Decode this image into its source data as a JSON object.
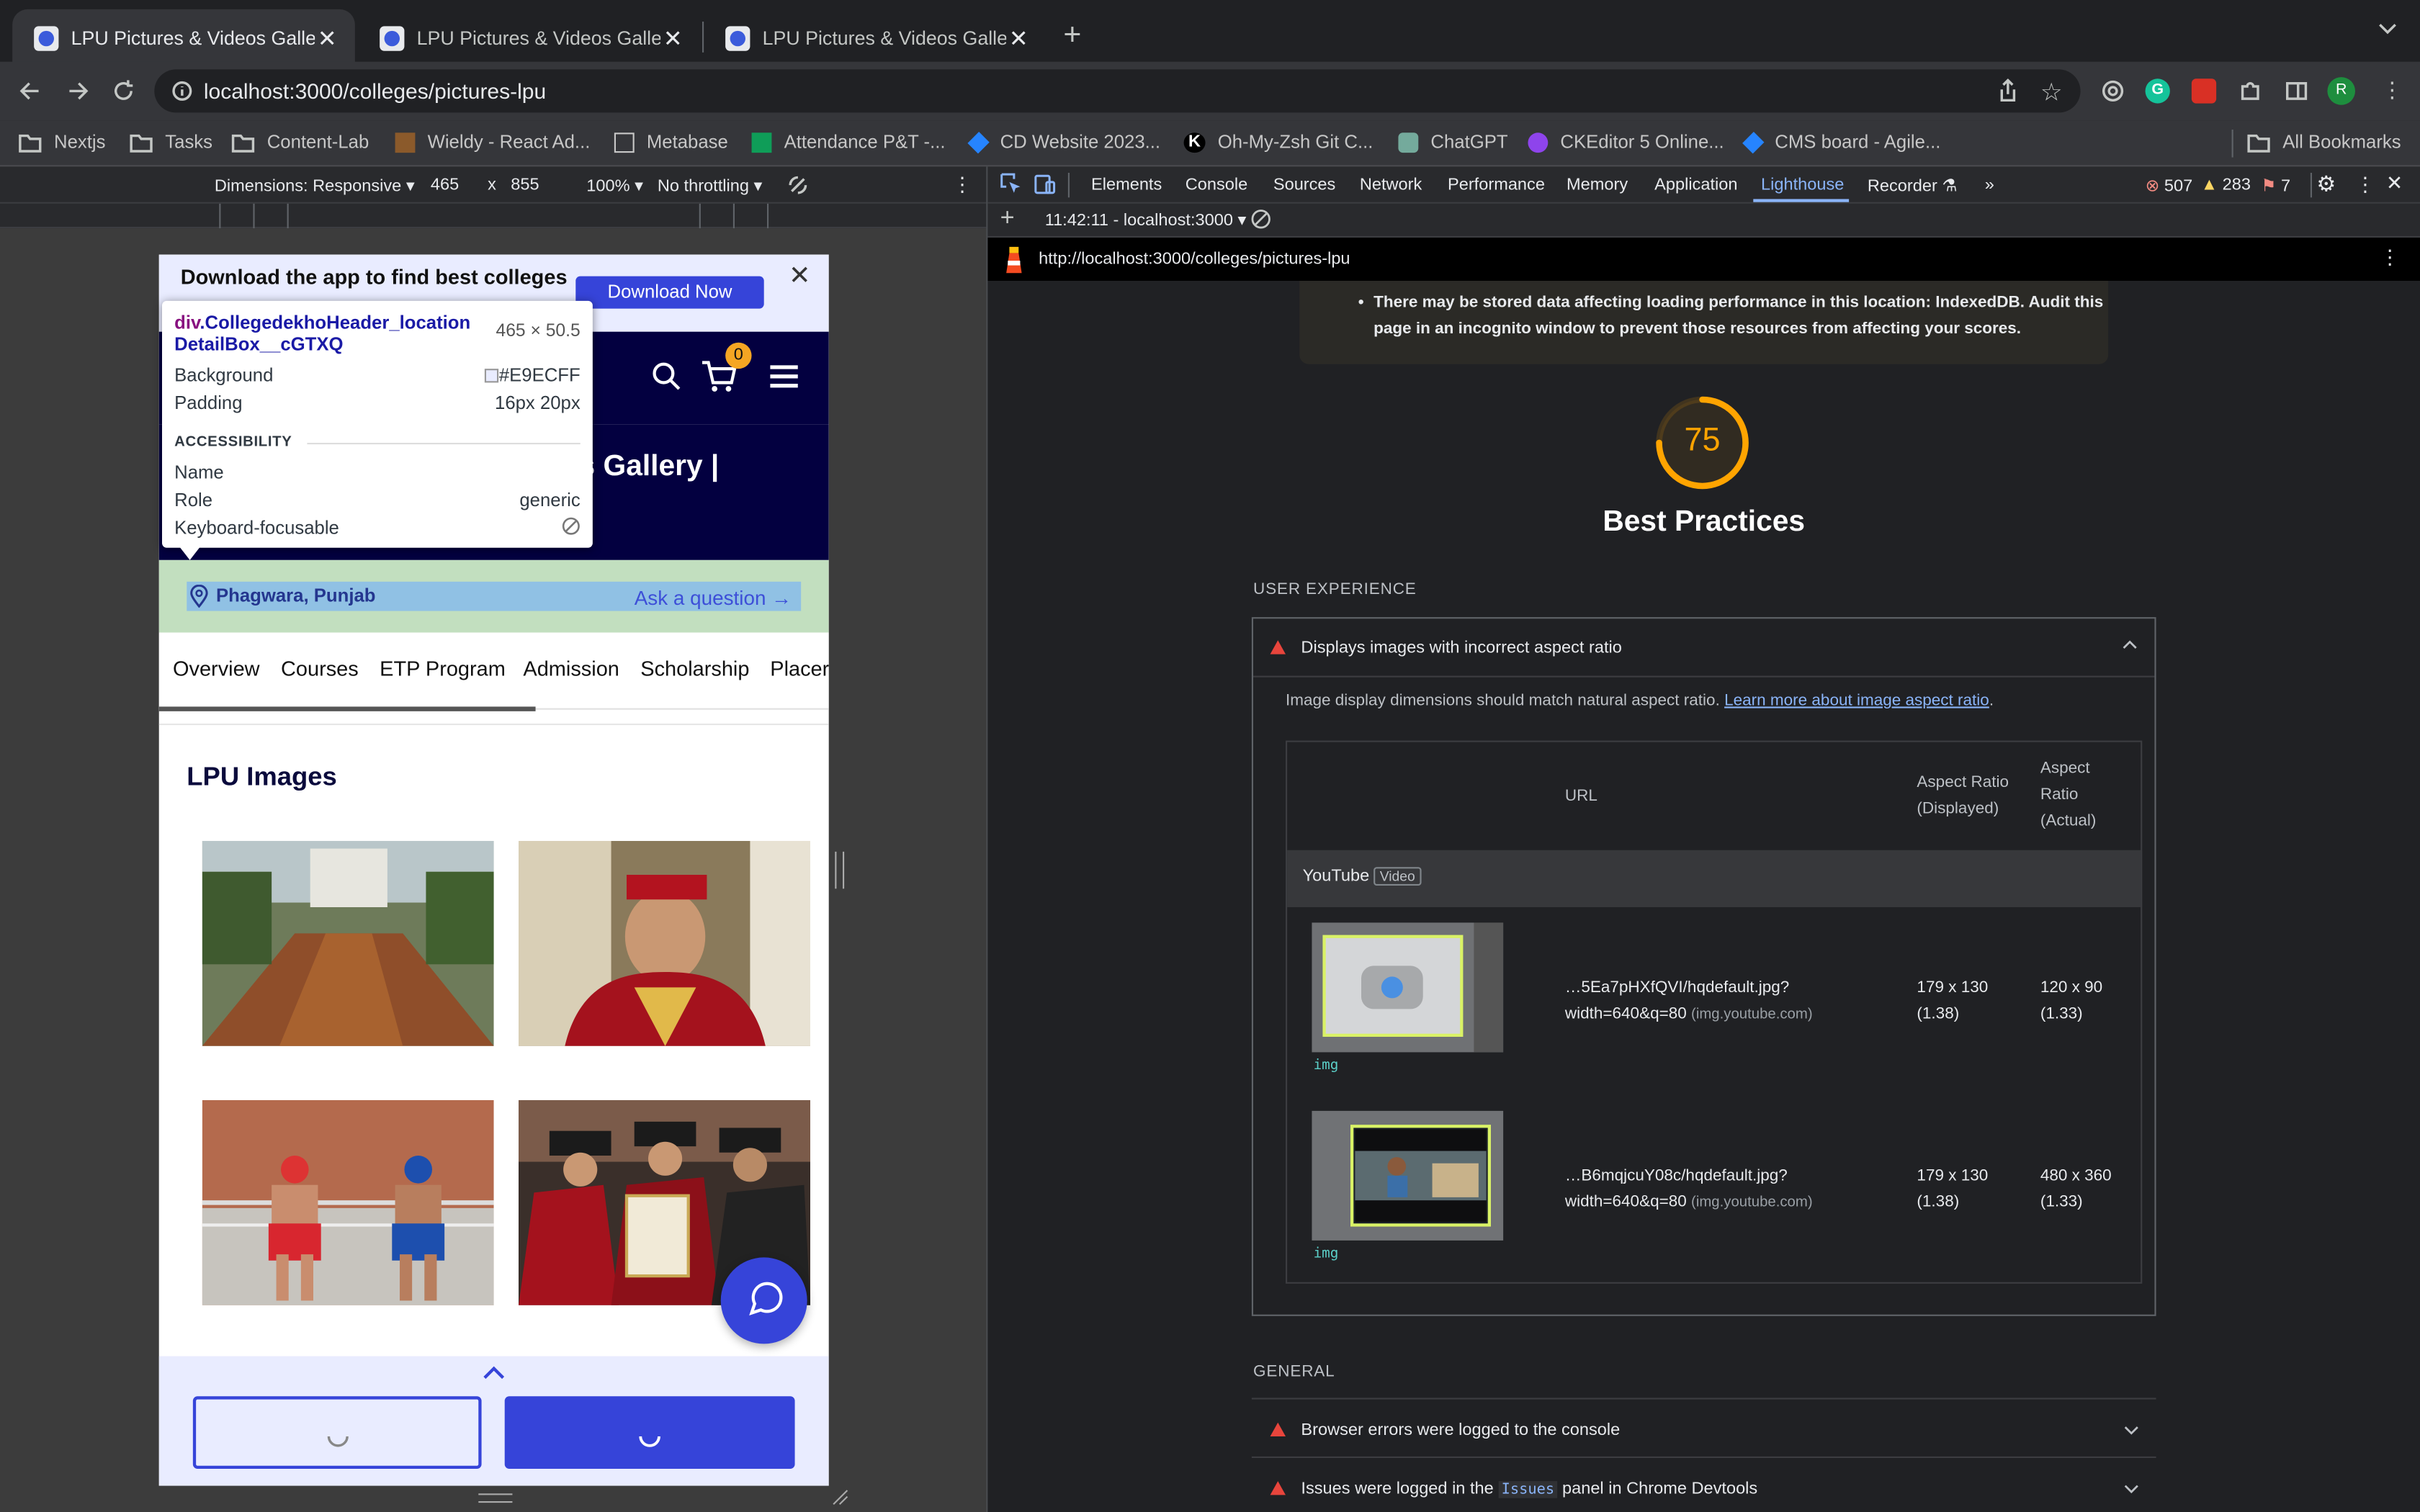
{
  "browser": {
    "tabs": [
      {
        "title": "LPU Pictures & Videos Gallery"
      },
      {
        "title": "LPU Pictures & Videos Gallery"
      },
      {
        "title": "LPU Pictures & Videos Gallery"
      }
    ],
    "url": "localhost:3000/colleges/pictures-lpu",
    "bookmarks": [
      "Nextjs",
      "Tasks",
      "Content-Lab",
      "Wieldy - React Ad...",
      "Metabase",
      "Attendance P&T -...",
      "CD Website 2023...",
      "Oh-My-Zsh Git C...",
      "ChatGPT",
      "CKEditor 5 Online...",
      "CMS board - Agile..."
    ],
    "all_bookmarks": "All Bookmarks",
    "profile_initial": "R",
    "ext_g": "G"
  },
  "device_toolbar": {
    "dimensions": "Dimensions: Responsive",
    "width": "465",
    "x": "x",
    "height": "855",
    "zoom": "100%",
    "throttling": "No throttling"
  },
  "devtools": {
    "tabs": [
      "Elements",
      "Console",
      "Sources",
      "Network",
      "Performance",
      "Memory",
      "Application",
      "Lighthouse",
      "Recorder"
    ],
    "active_tab": "Lighthouse",
    "errors": "507",
    "warnings": "283",
    "issues": "7",
    "report_select": "11:42:11 - localhost:3000",
    "report_url": "http://localhost:3000/colleges/pictures-lpu"
  },
  "lighthouse": {
    "warning_line1": "There may be stored data affecting loading performance in this location: IndexedDB. Audit this",
    "warning_line2": "page in an incognito window to prevent those resources from affecting your scores.",
    "score": "75",
    "score_value": 0.75,
    "score_color": "#ffa400",
    "category": "Best Practices",
    "section_ux": "USER EXPERIENCE",
    "audit_title": "Displays images with incorrect aspect ratio",
    "audit_desc": "Image display dimensions should match natural aspect ratio.",
    "audit_link": "Learn more about image aspect ratio",
    "audit_period": ".",
    "table_headers": {
      "url": "URL",
      "displayed_1": "Aspect Ratio",
      "displayed_2": "(Displayed)",
      "actual_1": "Aspect",
      "actual_2": "Ratio",
      "actual_3": "(Actual)"
    },
    "entity": "YouTube",
    "entity_tag": "Video",
    "rows": [
      {
        "url": "…5Ea7pHXfQVI/hqdefault.jpg?",
        "url2": "width=640&q=80",
        "host": "(img.youtube.com)",
        "displayed": "179 x 130",
        "displayed_ratio": "(1.38)",
        "actual": "120 x 90",
        "actual_ratio": "(1.33)",
        "tag": "img"
      },
      {
        "url": "…B6mqjcuY08c/hqdefault.jpg?",
        "url2": "width=640&q=80",
        "host": "(img.youtube.com)",
        "displayed": "179 x 130",
        "displayed_ratio": "(1.38)",
        "actual": "480 x 360",
        "actual_ratio": "(1.33)",
        "tag": "img"
      }
    ],
    "section_general": "GENERAL",
    "general": [
      {
        "pre": "Browser errors were logged to the console",
        "code": "",
        "post": ""
      },
      {
        "pre": "Issues were logged in the ",
        "code": "Issues",
        "post": " panel in Chrome Devtools"
      }
    ]
  },
  "page": {
    "banner_text": "Download the app to find best colleges",
    "banner_button": "Download Now",
    "cart_count": "0",
    "hero_title_visible": "s Gallery |",
    "location": "Phagwara, Punjab",
    "ask": "Ask a question",
    "nav_tabs": [
      "Overview",
      "Courses",
      "ETP Program",
      "Admission",
      "Scholarship",
      "Placer"
    ],
    "section_title": "LPU Images"
  },
  "inspector": {
    "selector_tag": "div",
    "selector_class_1": ".CollegedekhoHeader_location",
    "selector_class_2": "DetailBox__cGTXQ",
    "size": "465 × 50.5",
    "background_label": "Background",
    "background_value": "#E9ECFF",
    "background_color": "#e9ecff",
    "padding_label": "Padding",
    "padding_value": "16px 20px",
    "accessibility": "ACCESSIBILITY",
    "name_label": "Name",
    "role_label": "Role",
    "role_value": "generic",
    "focus_label": "Keyboard-focusable"
  }
}
